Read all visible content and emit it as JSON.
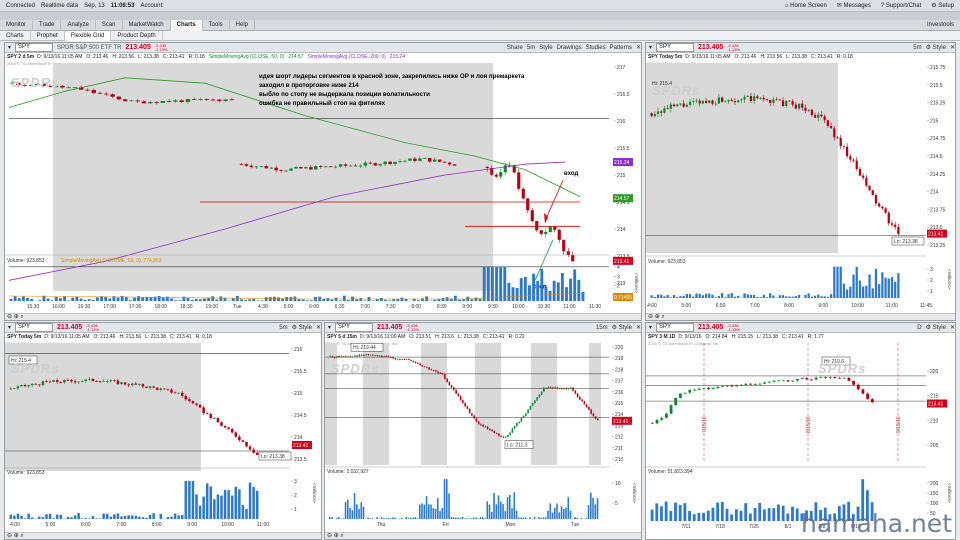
{
  "statusbar": {
    "connected": "Connected",
    "realtime": "Realtime data",
    "date": "Sep, 13",
    "time": "11:08:53",
    "account": "Account:",
    "home": "Home Screen",
    "messages": "Messages",
    "support": "Support/Chat",
    "setup": "Setup"
  },
  "main_tabs": [
    "Monitor",
    "Trade",
    "Analyze",
    "Scan",
    "MarketWatch",
    "Charts",
    "Tools",
    "Help"
  ],
  "main_tabs_right": "Investools",
  "sub_tabs": [
    "Charts",
    "Prophet",
    "Flexible Grid",
    "Product Depth"
  ],
  "colors": {
    "up": "#0a8a2a",
    "down": "#b00012",
    "price_red": "#d0021b"
  },
  "panels": {
    "p1": {
      "symbol": "SPY",
      "desc": "SPDR S&P 500 ETF TR",
      "price": "213.405",
      "chg": "-2.435",
      "chg_pct": "-1.13%",
      "interval": "5m",
      "buttons": [
        "Share",
        "Style",
        "Drawings",
        "Studies",
        "Patterns"
      ],
      "title": "SPY 2 d 5m",
      "ohlc": [
        "D: 9/13/16 11:05 AM",
        "O: 213.46",
        "H: 213.56",
        "L: 213.38",
        "C: 213.41",
        "R: 0.18"
      ],
      "studies": [
        "SimpleMovingAvg (CLOSE, 50, 0)",
        "214.57",
        "SimpleMovingAvg (CLOSE, 200, 0)",
        "215.24"
      ],
      "copyright": "2016 © TD Ameritrade IP Company, Inc.",
      "yticks": [
        "217",
        "216.5",
        "216",
        "215.5",
        "215",
        "214.5",
        "214",
        "213.5",
        "213"
      ],
      "markers": [
        "215.24",
        "214.57",
        "213.41"
      ],
      "volume_label": "Volume",
      "volume_value": "923,853",
      "volume_study": "SimpleMovingAvg (VOLUME, 50, 0)",
      "volume_study_value": "774,853",
      "volume_marker": "0.71495",
      "volume_unit": "<millions>",
      "vyticks": [
        "4",
        "3",
        "2",
        "1"
      ],
      "xticks": [
        "15:30",
        "16:00",
        "16:30",
        "17:00",
        "17:30",
        "18:00",
        "18:30",
        "19:00",
        "Tue",
        "4:30",
        "5:00",
        "6:00",
        "6:30",
        "7:00",
        "7:30",
        "8:00",
        "8:30",
        "9:00",
        "9:30",
        "10:00",
        "10:30",
        "11:00",
        "11:30"
      ],
      "annotations": {
        "entry": "вход",
        "stop": "стоп"
      }
    },
    "p2": {
      "symbol": "SPY",
      "price": "213.405",
      "chg": "-2.435",
      "chg_pct": "-1.13%",
      "interval": "5m",
      "title": "SPY Today 5m",
      "ohlc": [
        "D: 9/13/16 11:05 AM",
        "O: 213.46",
        "H: 213.56",
        "L: 213.38",
        "C: 213.41",
        "R: 0.18"
      ],
      "copyright": "2016 © TD Ameritrade IP Company, Inc.",
      "hi": "Hi: 215.4",
      "lo": "Lo: 213.38",
      "marker": "213.41",
      "yticks": [
        "215.75",
        "215.5",
        "215.25",
        "215",
        "214.75",
        "214.5",
        "214.25",
        "214",
        "213.75",
        "213.5",
        "213.25"
      ],
      "volume_label": "Volume",
      "volume_value": "923,853",
      "volume_unit": "<millions>",
      "vyticks": [
        "3",
        "2",
        "1"
      ],
      "xticks": [
        "4:00",
        "5:00",
        "6:00",
        "7:00",
        "8:00",
        "9:00",
        "10:00",
        "11:00",
        "11:45"
      ]
    },
    "p3": {
      "symbol": "SPY",
      "price": "213.405",
      "chg": "-2.435",
      "chg_pct": "-1.13%",
      "interval": "5m",
      "title": "SPY Today 5m",
      "ohlc": [
        "D: 9/13/16 11:05 AM",
        "O: 213.46",
        "H: 213.56",
        "L: 213.38",
        "C: 213.41",
        "R: 0.18"
      ],
      "copyright": "2016 © TD Ameritrade IP Company, Inc.",
      "hi": "Hi: 215.4",
      "lo": "Lo: 213.38",
      "marker": "213.41",
      "yticks": [
        "216",
        "215.5",
        "215",
        "214.5",
        "214",
        "213.5"
      ],
      "volume_label": "Volume",
      "volume_value": "923,853",
      "volume_unit": "<millions>",
      "vyticks": [
        "3",
        "2",
        "1"
      ],
      "xticks": [
        "4:00",
        "5:00",
        "6:00",
        "7:00",
        "8:00",
        "9:00",
        "10:00",
        "11:00"
      ]
    },
    "p4": {
      "symbol": "SPY",
      "price": "213.405",
      "chg": "-2.435",
      "chg_pct": "-1.13%",
      "interval": "15m",
      "title": "SPY 5 d 15m",
      "ohlc": [
        "D: 9/13/16 11:00 AM",
        "O: 213.51",
        "H: 213.6",
        "L: 213.38",
        "C: 213.41",
        "R: 0.22"
      ],
      "copyright": "2016 © TD Ameritrade IP Company, Inc.",
      "hi": "Hi: 219.44",
      "lo": "Lo: 211.3",
      "marker": "213.41",
      "yticks": [
        "220",
        "219",
        "218",
        "217",
        "216",
        "215",
        "214",
        "213",
        "212",
        "211",
        "210"
      ],
      "volume_label": "Volume",
      "volume_value": "2,032,927",
      "volume_unit": "<millions>",
      "vyticks": [
        "10",
        "5"
      ],
      "xticks": [
        "Thu",
        "Fri",
        "Mon",
        "Tue"
      ]
    },
    "p5": {
      "symbol": "SPY",
      "price": "213.405",
      "chg": "-2.435",
      "chg_pct": "-1.13%",
      "interval": "D",
      "title": "SPY 3 M 1D",
      "ohlc": [
        "D: 9/13/16",
        "O: 214.84",
        "H: 215.15",
        "L: 213.38",
        "C: 213.41",
        "R: 1.77"
      ],
      "copyright": "2016 © TD Ameritrade IP Company, Inc.",
      "hi": "Hi: 219.6",
      "marker": "213.41",
      "yticks": [
        "220",
        "215",
        "210",
        "205"
      ],
      "vlines": [
        "7/15/16",
        "8/15/16",
        "9/15/16"
      ],
      "volume_label": "Volume",
      "volume_value": "51,823,394",
      "volume_unit": "<millions>",
      "vyticks": [
        "200",
        "150",
        "100",
        "50"
      ],
      "xticks": [
        "7/11",
        "7/18",
        "7/25",
        "8/1",
        "8/8",
        "8/15"
      ]
    }
  },
  "note": [
    "идея шорт лидеры сегментов в красной зоне, закрепились ниже ОР  и лоя премаркета",
    "заходил в проторговке ниже 214",
    "выбло по стопу не выдержала позиции волатильности",
    "ошибка не правильный стоп на фитилях"
  ],
  "watermark": "hamaha.net"
}
